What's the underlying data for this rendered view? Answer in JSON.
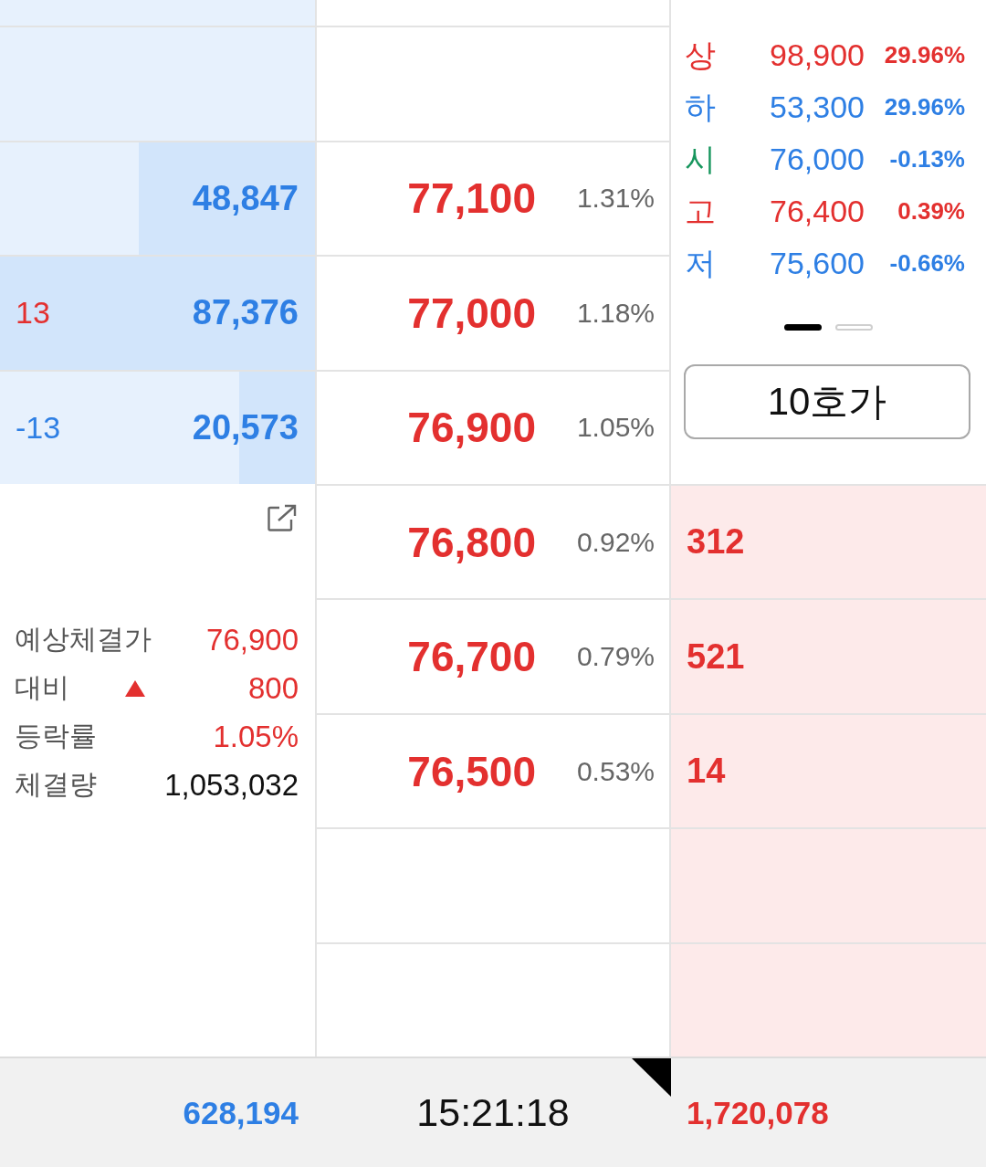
{
  "ask_rows": [
    {},
    {
      "quantity": "48,847",
      "level": 0.56,
      "price": "77,100",
      "rate": "1.31%"
    },
    {
      "change": {
        "text": "13",
        "color": "#e3302f"
      },
      "quantity": "87,376",
      "level": 1,
      "price": "77,000",
      "rate": "1.18%"
    },
    {
      "change": {
        "text": "-13",
        "color": "#2e7fe4"
      },
      "quantity": "20,573",
      "level": 0.24,
      "price": "76,900",
      "rate": "1.05%"
    }
  ],
  "price_stats": [
    {
      "label": {
        "text": "상",
        "color": "#e3302f"
      },
      "value": "98,900",
      "color": "#e3302f",
      "rate": "29.96%"
    },
    {
      "label": {
        "text": "하",
        "color": "#2e7fe4"
      },
      "value": "53,300",
      "color": "#2e7fe4",
      "rate": "29.96%"
    },
    {
      "label": {
        "text": "시",
        "color": "#17965d"
      },
      "value": "76,000",
      "color": "#2e7fe4",
      "rate": "-0.13%"
    },
    {
      "label": {
        "text": "고",
        "color": "#e3302f"
      },
      "value": "76,400",
      "color": "#e3302f",
      "rate": "0.39%"
    },
    {
      "label": {
        "text": "저",
        "color": "#2e7fe4"
      },
      "value": "75,600",
      "color": "#2e7fe4",
      "rate": "-0.66%"
    }
  ],
  "pages": [
    {
      "selected": true
    },
    {
      "selected": false
    }
  ],
  "depth_button": {
    "label": "10호가"
  },
  "summary": [
    {
      "label": "예상체결가",
      "value": "76,900",
      "color": "#e3302f"
    },
    {
      "label": "대비",
      "arrow": true,
      "value": "800",
      "color": "#e3302f"
    },
    {
      "label": "등락률",
      "value": "1.05%",
      "color": "#e3302f"
    },
    {
      "label": "체결량",
      "value": "1,053,032",
      "color": "#111111"
    }
  ],
  "bid_rows": [
    {
      "price": "76,800",
      "rate": "0.92%",
      "quantity": "312"
    },
    {
      "price": "76,700",
      "rate": "0.79%",
      "quantity": "521"
    },
    {
      "price": "76,500",
      "rate": "0.53%",
      "quantity": "14"
    },
    {},
    {}
  ],
  "totals": {
    "ask_total": "628,194",
    "time": "15:21:18",
    "bid_total": "1,720,078"
  }
}
